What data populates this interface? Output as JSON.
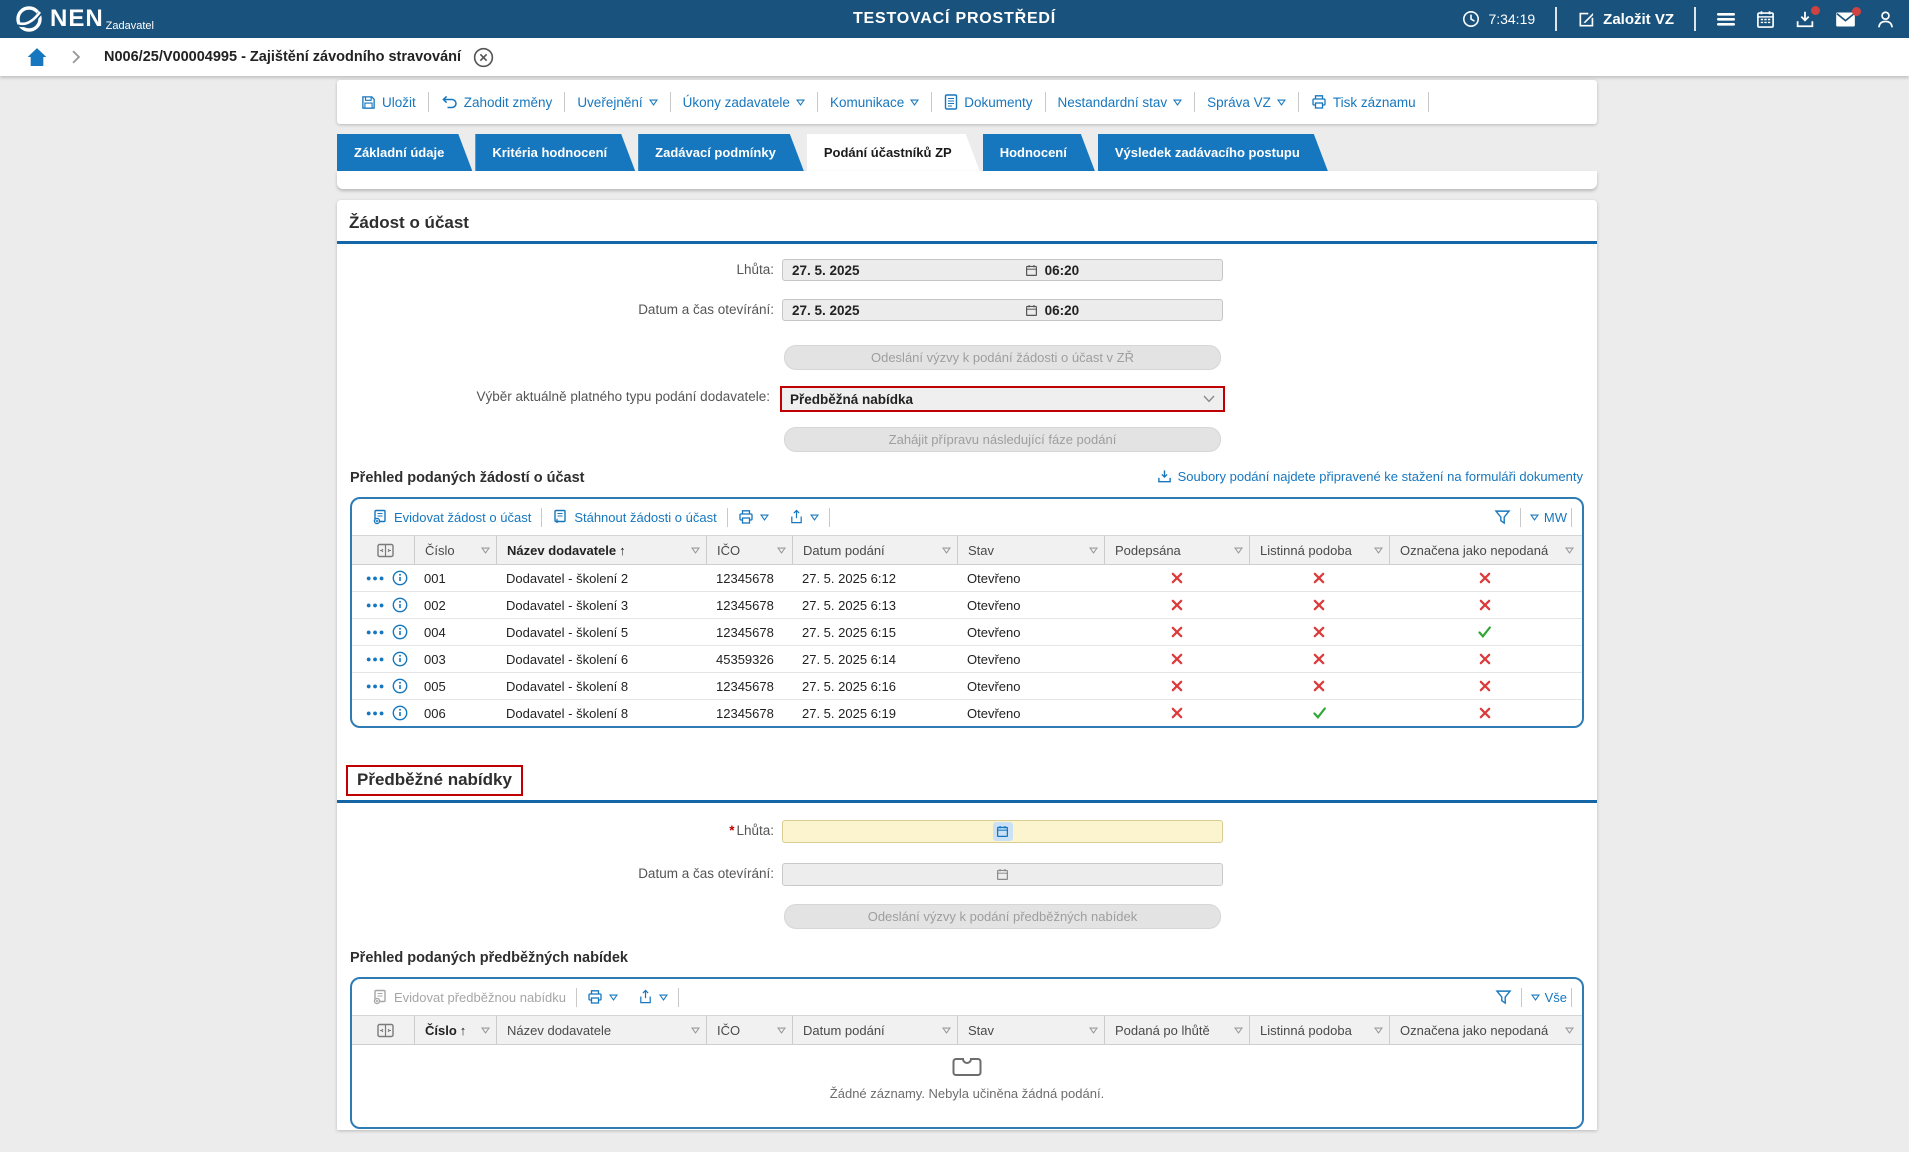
{
  "app": {
    "brand": "NEN",
    "brand_sub": "Zadavatel",
    "env_title": "TESTOVACÍ PROSTŘEDÍ",
    "clock": "7:34:19",
    "create_vz": "Založit VZ"
  },
  "breadcrumb": {
    "title": "N006/25/V00004995 - Zajištění závodního stravování"
  },
  "toolbar": [
    {
      "key": "ulozit",
      "label": "Uložit",
      "icon": "save",
      "dropdown": false
    },
    {
      "key": "zahodit-zmeny",
      "label": "Zahodit změny",
      "icon": "undo",
      "dropdown": false
    },
    {
      "key": "uverejneni",
      "label": "Uveřejnění",
      "icon": null,
      "dropdown": true
    },
    {
      "key": "ukony-zadavatele",
      "label": "Úkony zadavatele",
      "icon": null,
      "dropdown": true
    },
    {
      "key": "komunikace",
      "label": "Komunikace",
      "icon": null,
      "dropdown": true
    },
    {
      "key": "dokumenty",
      "label": "Dokumenty",
      "icon": "document",
      "dropdown": false
    },
    {
      "key": "nestandardni-stav",
      "label": "Nestandardní stav",
      "icon": null,
      "dropdown": true
    },
    {
      "key": "sprava-vz",
      "label": "Správa VZ",
      "icon": null,
      "dropdown": true
    },
    {
      "key": "tisk-zaznamu",
      "label": "Tisk záznamu",
      "icon": "print",
      "dropdown": false
    }
  ],
  "tabs": [
    {
      "label": "Základní údaje",
      "active": false
    },
    {
      "label": "Kritéria hodnocení",
      "active": false
    },
    {
      "label": "Zadávací podmínky",
      "active": false
    },
    {
      "label": "Podání účastníků ZP",
      "active": true
    },
    {
      "label": "Hodnocení",
      "active": false
    },
    {
      "label": "Výsledek zadávacího postupu",
      "active": false
    }
  ],
  "request_section": {
    "title": "Žádost o účast",
    "deadline_label": "Lhůta:",
    "deadline_date": "27. 5. 2025",
    "deadline_time": "06:20",
    "opening_label": "Datum a čas otevírání:",
    "opening_date": "27. 5. 2025",
    "opening_time": "06:20",
    "send_request_button": "Odeslání výzvy k podání žádosti o účast v ZŘ",
    "submission_type_label": "Výběr aktuálně platného typu podání dodavatele:",
    "submission_type_value": "Předběžná nabídka",
    "next_phase_button": "Zahájit přípravu následující fáze podání",
    "overview_title": "Přehled podaných žádostí o účast",
    "download_link": "Soubory podání najdete připravené ke stažení na formuláři dokumenty",
    "table": {
      "action1": "Evidovat žádost o účast",
      "action2": "Stáhnout žádosti o účast",
      "view_label": "MW",
      "columns": [
        "Číslo",
        "Název dodavatele",
        "IČO",
        "Datum podání",
        "Stav",
        "Podepsána",
        "Listinná podoba",
        "Označena jako nepodaná"
      ],
      "sorted_column": "Název dodavatele",
      "rows": [
        [
          "001",
          "Dodavatel - školení 2",
          "12345678",
          "27. 5. 2025 6:12",
          "Otevřeno",
          false,
          false,
          false
        ],
        [
          "002",
          "Dodavatel - školení 3",
          "12345678",
          "27. 5. 2025 6:13",
          "Otevřeno",
          false,
          false,
          false
        ],
        [
          "004",
          "Dodavatel - školení 5",
          "12345678",
          "27. 5. 2025 6:15",
          "Otevřeno",
          false,
          false,
          true
        ],
        [
          "003",
          "Dodavatel - školení 6",
          "45359326",
          "27. 5. 2025 6:14",
          "Otevřeno",
          false,
          false,
          false
        ],
        [
          "005",
          "Dodavatel - školení 8",
          "12345678",
          "27. 5. 2025 6:16",
          "Otevřeno",
          false,
          false,
          false
        ],
        [
          "006",
          "Dodavatel - školení 8",
          "12345678",
          "27. 5. 2025 6:19",
          "Otevřeno",
          false,
          true,
          false
        ]
      ]
    }
  },
  "preliminary_section": {
    "title": "Předběžné nabídky",
    "deadline_label": "Lhůta:",
    "required_mark": "*",
    "opening_label": "Datum a čas otevírání:",
    "send_button": "Odeslání výzvy k podání předběžných nabídek",
    "overview_title": "Přehled podaných předběžných nabídek",
    "table": {
      "action1": "Evidovat předběžnou nabídku",
      "view_label": "Vše",
      "columns": [
        "Číslo",
        "Název dodavatele",
        "IČO",
        "Datum podání",
        "Stav",
        "Podaná po lhůtě",
        "Listinná podoba",
        "Označena jako nepodaná"
      ],
      "sorted_column": "Číslo",
      "empty_text": "Žádné záznamy. Nebyla učiněna žádná podání."
    }
  },
  "colors": {
    "header_bg": "#19527c",
    "accent_blue": "#1777be",
    "section_rule_blue": "#1566a6",
    "table_border_blue": "#2f7cb5",
    "error_red": "#c00000",
    "cross_red": "#dc3a3a",
    "check_green": "#2ea833",
    "required_field_yellow": "#fbf4cf",
    "badge_red": "#cf4242"
  }
}
